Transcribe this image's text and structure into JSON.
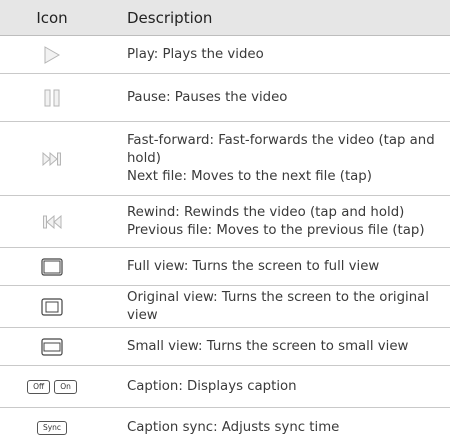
{
  "header": {
    "icon": "Icon",
    "description": "Description"
  },
  "rows": [
    {
      "icon": "play-icon",
      "lines": [
        "Play: Plays the video"
      ]
    },
    {
      "icon": "pause-icon",
      "lines": [
        "Pause: Pauses the video"
      ]
    },
    {
      "icon": "fast-forward-icon",
      "lines": [
        "Fast-forward: Fast-forwards the video (tap and",
        "hold)",
        "Next file: Moves to the next file (tap)"
      ]
    },
    {
      "icon": "rewind-icon",
      "lines": [
        "Rewind: Rewinds the video (tap and hold)",
        "Previous file: Moves to the previous file (tap)"
      ]
    },
    {
      "icon": "full-view-icon",
      "lines": [
        "Full view: Turns the screen to full view"
      ]
    },
    {
      "icon": "original-view-icon",
      "lines": [
        "Original view: Turns the screen to the original view"
      ]
    },
    {
      "icon": "small-view-icon",
      "lines": [
        "Small view: Turns the screen to small view"
      ]
    },
    {
      "icon": "caption-toggle-icon",
      "keys": [
        "Off",
        "On"
      ],
      "lines": [
        "Caption: Displays caption"
      ]
    },
    {
      "icon": "sync-icon",
      "keys": [
        "Sync"
      ],
      "lines": [
        "Caption sync: Adjusts sync time"
      ]
    }
  ]
}
